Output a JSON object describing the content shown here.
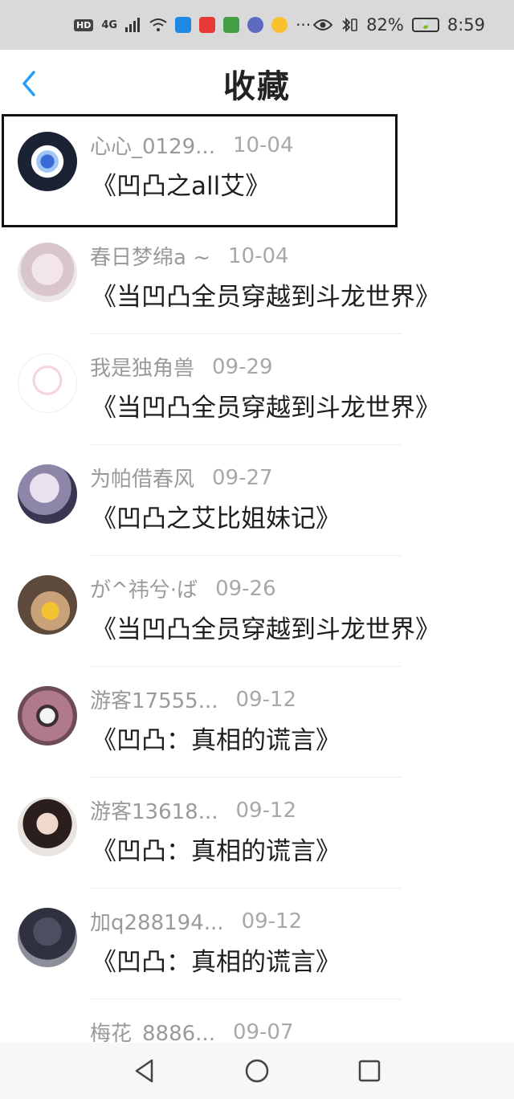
{
  "status_bar": {
    "network_badge": "HD",
    "signal": "4G",
    "battery_percent": "82%",
    "time": "8:59"
  },
  "header": {
    "title": "收藏",
    "back_icon": "chevron-left-icon",
    "accent_color": "#2a9df4"
  },
  "favorites": [
    {
      "author": "心心_0129...",
      "date": "10-04",
      "title": "《凹凸之all艾》",
      "highlighted": true
    },
    {
      "author": "春日梦绵a ~",
      "date": "10-04",
      "title": "《当凹凸全员穿越到斗龙世界》"
    },
    {
      "author": "我是独角兽",
      "date": "09-29",
      "title": "《当凹凸全员穿越到斗龙世界》"
    },
    {
      "author": "为帕借春风",
      "date": "09-27",
      "title": "《凹凸之艾比姐妹记》"
    },
    {
      "author": "が^祎兮·ば",
      "date": "09-26",
      "title": "《当凹凸全员穿越到斗龙世界》"
    },
    {
      "author": "游客17555...",
      "date": "09-12",
      "title": "《凹凸：真相的谎言》"
    },
    {
      "author": "游客13618...",
      "date": "09-12",
      "title": "《凹凸：真相的谎言》"
    },
    {
      "author": "加q288194...",
      "date": "09-12",
      "title": "《凹凸：真相的谎言》"
    },
    {
      "author": "梅花_8886...",
      "date": "09-07",
      "title": ""
    }
  ],
  "nav_bar": {
    "back_icon": "triangle-back-icon",
    "home_icon": "circle-home-icon",
    "recents_icon": "square-recents-icon"
  }
}
